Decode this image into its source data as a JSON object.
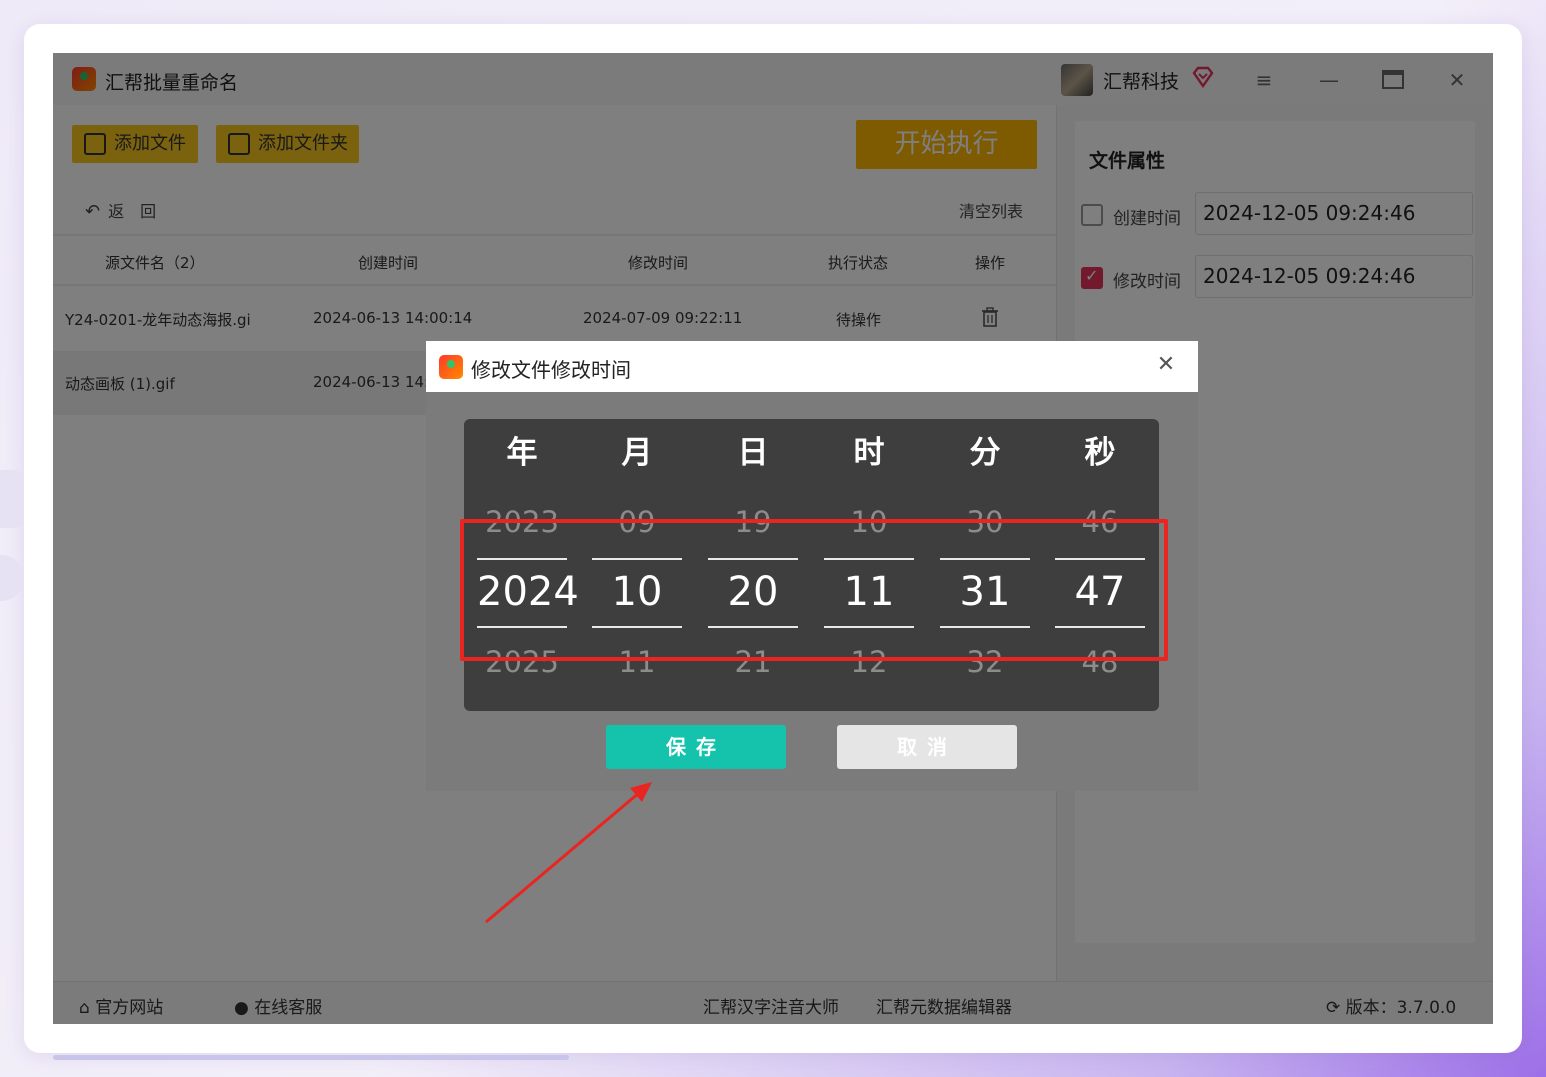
{
  "app": {
    "title": "汇帮批量重命名",
    "brand": "汇帮科技"
  },
  "toolbar": {
    "add_file": "添加文件",
    "add_folder": "添加文件夹",
    "start": "开始执行",
    "back": "返　回",
    "clear": "清空列表"
  },
  "table": {
    "headers": [
      "源文件名（2）",
      "创建时间",
      "修改时间",
      "执行状态",
      "操作"
    ],
    "rows": [
      {
        "name": "Y24-0201-龙年动态海报.gi",
        "created": "2024-06-13 14:00:14",
        "modified": "2024-07-09 09:22:11",
        "status": "待操作"
      },
      {
        "name": "动态画板 (1).gif",
        "created": "2024-06-13 14:"
      }
    ]
  },
  "right_panel": {
    "title": "文件属性",
    "created_label": "创建时间",
    "created_value": "2024-12-05 09:24:46",
    "created_checked": false,
    "modified_label": "修改时间",
    "modified_value": "2024-12-05 09:24:46",
    "modified_checked": true
  },
  "dialog": {
    "title": "修改文件修改时间",
    "columns": [
      {
        "head": "年",
        "prev": "2023",
        "cur": "2024",
        "next": "2025"
      },
      {
        "head": "月",
        "prev": "09",
        "cur": "10",
        "next": "11"
      },
      {
        "head": "日",
        "prev": "19",
        "cur": "20",
        "next": "21"
      },
      {
        "head": "时",
        "prev": "10",
        "cur": "11",
        "next": "12"
      },
      {
        "head": "分",
        "prev": "30",
        "cur": "31",
        "next": "32"
      },
      {
        "head": "秒",
        "prev": "46",
        "cur": "47",
        "next": "48"
      }
    ],
    "save": "保存",
    "cancel": "取消"
  },
  "footer": {
    "website": "官方网站",
    "support": "在线客服",
    "link1": "汇帮汉字注音大师",
    "link2": "汇帮元数据编辑器",
    "version": "版本：3.7.0.0"
  },
  "colors": {
    "accent_yellow": "#f4c41c",
    "start_orange": "#fdb400",
    "save_teal": "#15c3ad",
    "highlight_red": "#e82521",
    "check_pink": "#e6335a"
  }
}
